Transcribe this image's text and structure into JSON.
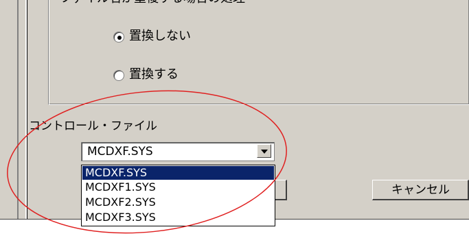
{
  "groupbox": {
    "title": "ファイル名が重複する場合の処理"
  },
  "radios": [
    {
      "label": "置換しない",
      "checked": true
    },
    {
      "label": "置換する",
      "checked": false
    }
  ],
  "control_file": {
    "label": "コントロール・ファイル",
    "selected_value": "MCDXF.SYS",
    "options": [
      "MCDXF.SYS",
      "MCDXF1.SYS",
      "MCDXF2.SYS",
      "MCDXF3.SYS"
    ]
  },
  "buttons": {
    "cancel_label": "キャンセル"
  },
  "colors": {
    "dialog_bg": "#d4d0c8",
    "selection_bg": "#0a246a",
    "annotation": "#e02020"
  }
}
